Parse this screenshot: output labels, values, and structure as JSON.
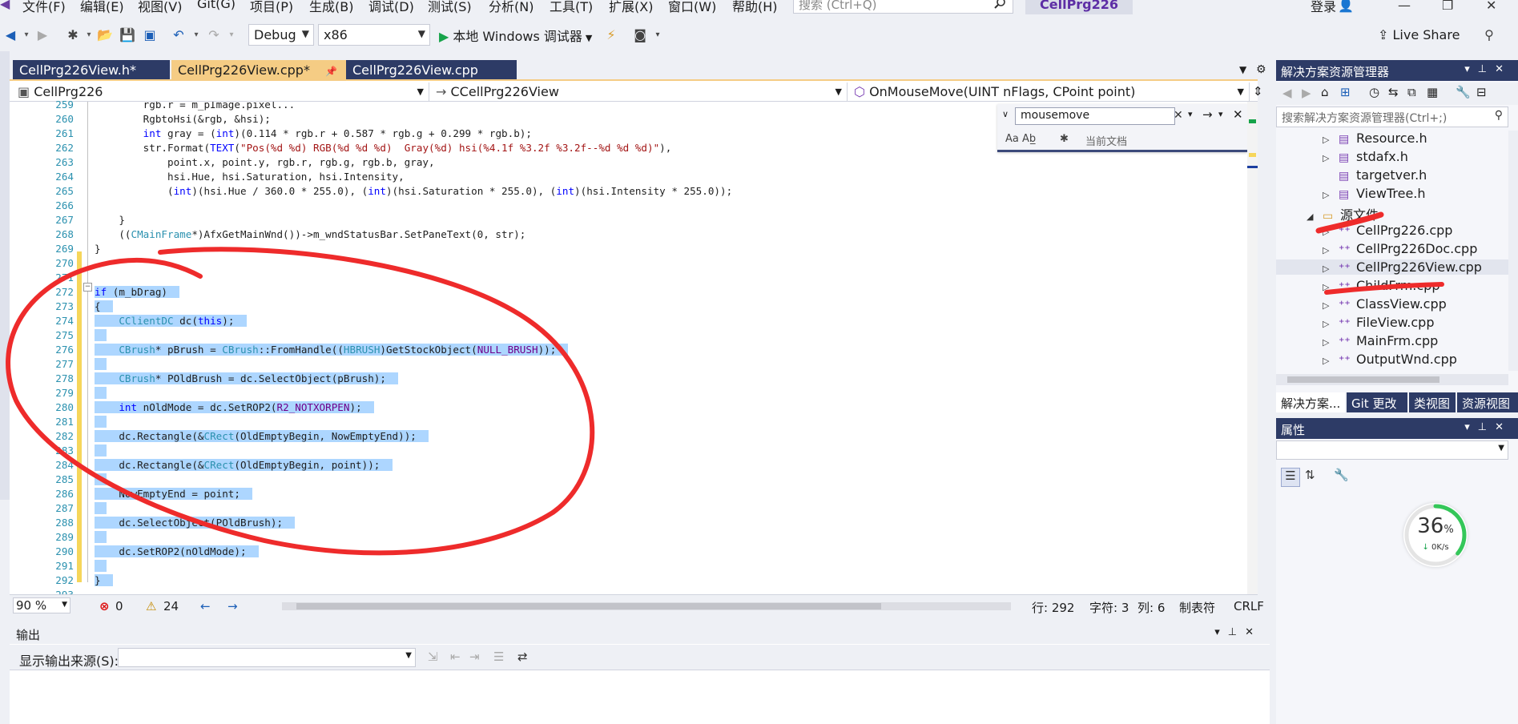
{
  "menu": {
    "items": [
      "文件(F)",
      "编辑(E)",
      "视图(V)",
      "Git(G)",
      "项目(P)",
      "生成(B)",
      "调试(D)",
      "测试(S)",
      "分析(N)",
      "工具(T)",
      "扩展(X)",
      "窗口(W)",
      "帮助(H)"
    ],
    "search_placeholder": "搜索 (Ctrl+Q)",
    "solution_name": "CellPrg226",
    "login": "登录"
  },
  "toolbar": {
    "config": "Debug",
    "platform": "x86",
    "run_label": "本地 Windows 调试器",
    "live_share": "Live Share"
  },
  "tabs": [
    {
      "label": "CellPrg226View.h*",
      "active": false
    },
    {
      "label": "CellPrg226View.cpp*",
      "active": true
    },
    {
      "label": "CellPrg226View.cpp",
      "active": false
    }
  ],
  "navbar": {
    "project": "CellPrg226",
    "class": "CCellPrg226View",
    "member": "OnMouseMove(UINT nFlags, CPoint point)"
  },
  "find": {
    "query": "mousemove",
    "options": "Aa  Ab̲",
    "scope": "当前文档"
  },
  "code_lines": [
    {
      "n": "259",
      "text": "        rgb.r = m_pImage.pixel..."
    },
    {
      "n": "260",
      "text": "        RgbtoHsi(&rgb, &hsi);"
    },
    {
      "n": "261",
      "text": "        int gray = (int)(0.114 * rgb.r + 0.587 * rgb.g + 0.299 * rgb.b);"
    },
    {
      "n": "262",
      "text": "        str.Format(TEXT(\"Pos(%d %d) RGB(%d %d %d)  Gray(%d) hsi(%4.1f %3.2f %3.2f--%d %d %d)\"),"
    },
    {
      "n": "263",
      "text": "            point.x, point.y, rgb.r, rgb.g, rgb.b, gray,"
    },
    {
      "n": "264",
      "text": "            hsi.Hue, hsi.Saturation, hsi.Intensity,"
    },
    {
      "n": "265",
      "text": "            (int)(hsi.Hue / 360.0 * 255.0), (int)(hsi.Saturation * 255.0), (int)(hsi.Intensity * 255.0));"
    },
    {
      "n": "266",
      "text": ""
    },
    {
      "n": "267",
      "text": "    }"
    },
    {
      "n": "268",
      "text": "    ((CMainFrame*)AfxGetMainWnd())->m_wndStatusBar.SetPaneText(0, str);"
    },
    {
      "n": "269",
      "text": "}"
    },
    {
      "n": "270",
      "text": ""
    },
    {
      "n": "271",
      "text": ""
    },
    {
      "n": "272",
      "text": "if (m_bDrag)"
    },
    {
      "n": "273",
      "text": "{"
    },
    {
      "n": "274",
      "text": "    CClientDC dc(this);"
    },
    {
      "n": "275",
      "text": ""
    },
    {
      "n": "276",
      "text": "    CBrush* pBrush = CBrush::FromHandle((HBRUSH)GetStockObject(NULL_BRUSH));"
    },
    {
      "n": "277",
      "text": ""
    },
    {
      "n": "278",
      "text": "    CBrush* POldBrush = dc.SelectObject(pBrush);"
    },
    {
      "n": "279",
      "text": ""
    },
    {
      "n": "280",
      "text": "    int nOldMode = dc.SetROP2(R2_NOTXORPEN);"
    },
    {
      "n": "281",
      "text": ""
    },
    {
      "n": "282",
      "text": "    dc.Rectangle(&CRect(OldEmptyBegin, NowEmptyEnd));"
    },
    {
      "n": "283",
      "text": ""
    },
    {
      "n": "284",
      "text": "    dc.Rectangle(&CRect(OldEmptyBegin, point));"
    },
    {
      "n": "285",
      "text": ""
    },
    {
      "n": "286",
      "text": "    NowEmptyEnd = point;"
    },
    {
      "n": "287",
      "text": ""
    },
    {
      "n": "288",
      "text": "    dc.SelectObject(POldBrush);"
    },
    {
      "n": "289",
      "text": ""
    },
    {
      "n": "290",
      "text": "    dc.SetROP2(nOldMode);"
    },
    {
      "n": "291",
      "text": ""
    },
    {
      "n": "292",
      "text": "}"
    },
    {
      "n": "293",
      "text": ""
    }
  ],
  "editor_status": {
    "zoom": "90 %",
    "errors": "0",
    "warnings": "24",
    "line": "行: 292",
    "char": "字符: 3",
    "col": "列: 6",
    "tabs": "制表符",
    "eol": "CRLF"
  },
  "solution_explorer": {
    "title": "解决方案资源管理器",
    "search_placeholder": "搜索解决方案资源管理器(Ctrl+;)",
    "items": [
      {
        "label": "Resource.h",
        "kind": "header"
      },
      {
        "label": "stdafx.h",
        "kind": "header"
      },
      {
        "label": "targetver.h",
        "kind": "header"
      },
      {
        "label": "ViewTree.h",
        "kind": "header"
      },
      {
        "label": "源文件",
        "kind": "folder"
      },
      {
        "label": "CellPrg226.cpp",
        "kind": "cpp"
      },
      {
        "label": "CellPrg226Doc.cpp",
        "kind": "cpp"
      },
      {
        "label": "CellPrg226View.cpp",
        "kind": "cpp"
      },
      {
        "label": "ChildFrm.cpp",
        "kind": "cpp"
      },
      {
        "label": "ClassView.cpp",
        "kind": "cpp"
      },
      {
        "label": "FileView.cpp",
        "kind": "cpp"
      },
      {
        "label": "MainFrm.cpp",
        "kind": "cpp"
      },
      {
        "label": "OutputWnd.cpp",
        "kind": "cpp"
      }
    ],
    "bottom_tabs": [
      "解决方案...",
      "Git 更改",
      "类视图",
      "资源视图"
    ]
  },
  "properties": {
    "title": "属性"
  },
  "speed_widget": {
    "percent": "36",
    "unit": "%",
    "rate": "0K/s"
  },
  "output": {
    "title": "输出",
    "source_label": "显示输出来源(S):"
  }
}
